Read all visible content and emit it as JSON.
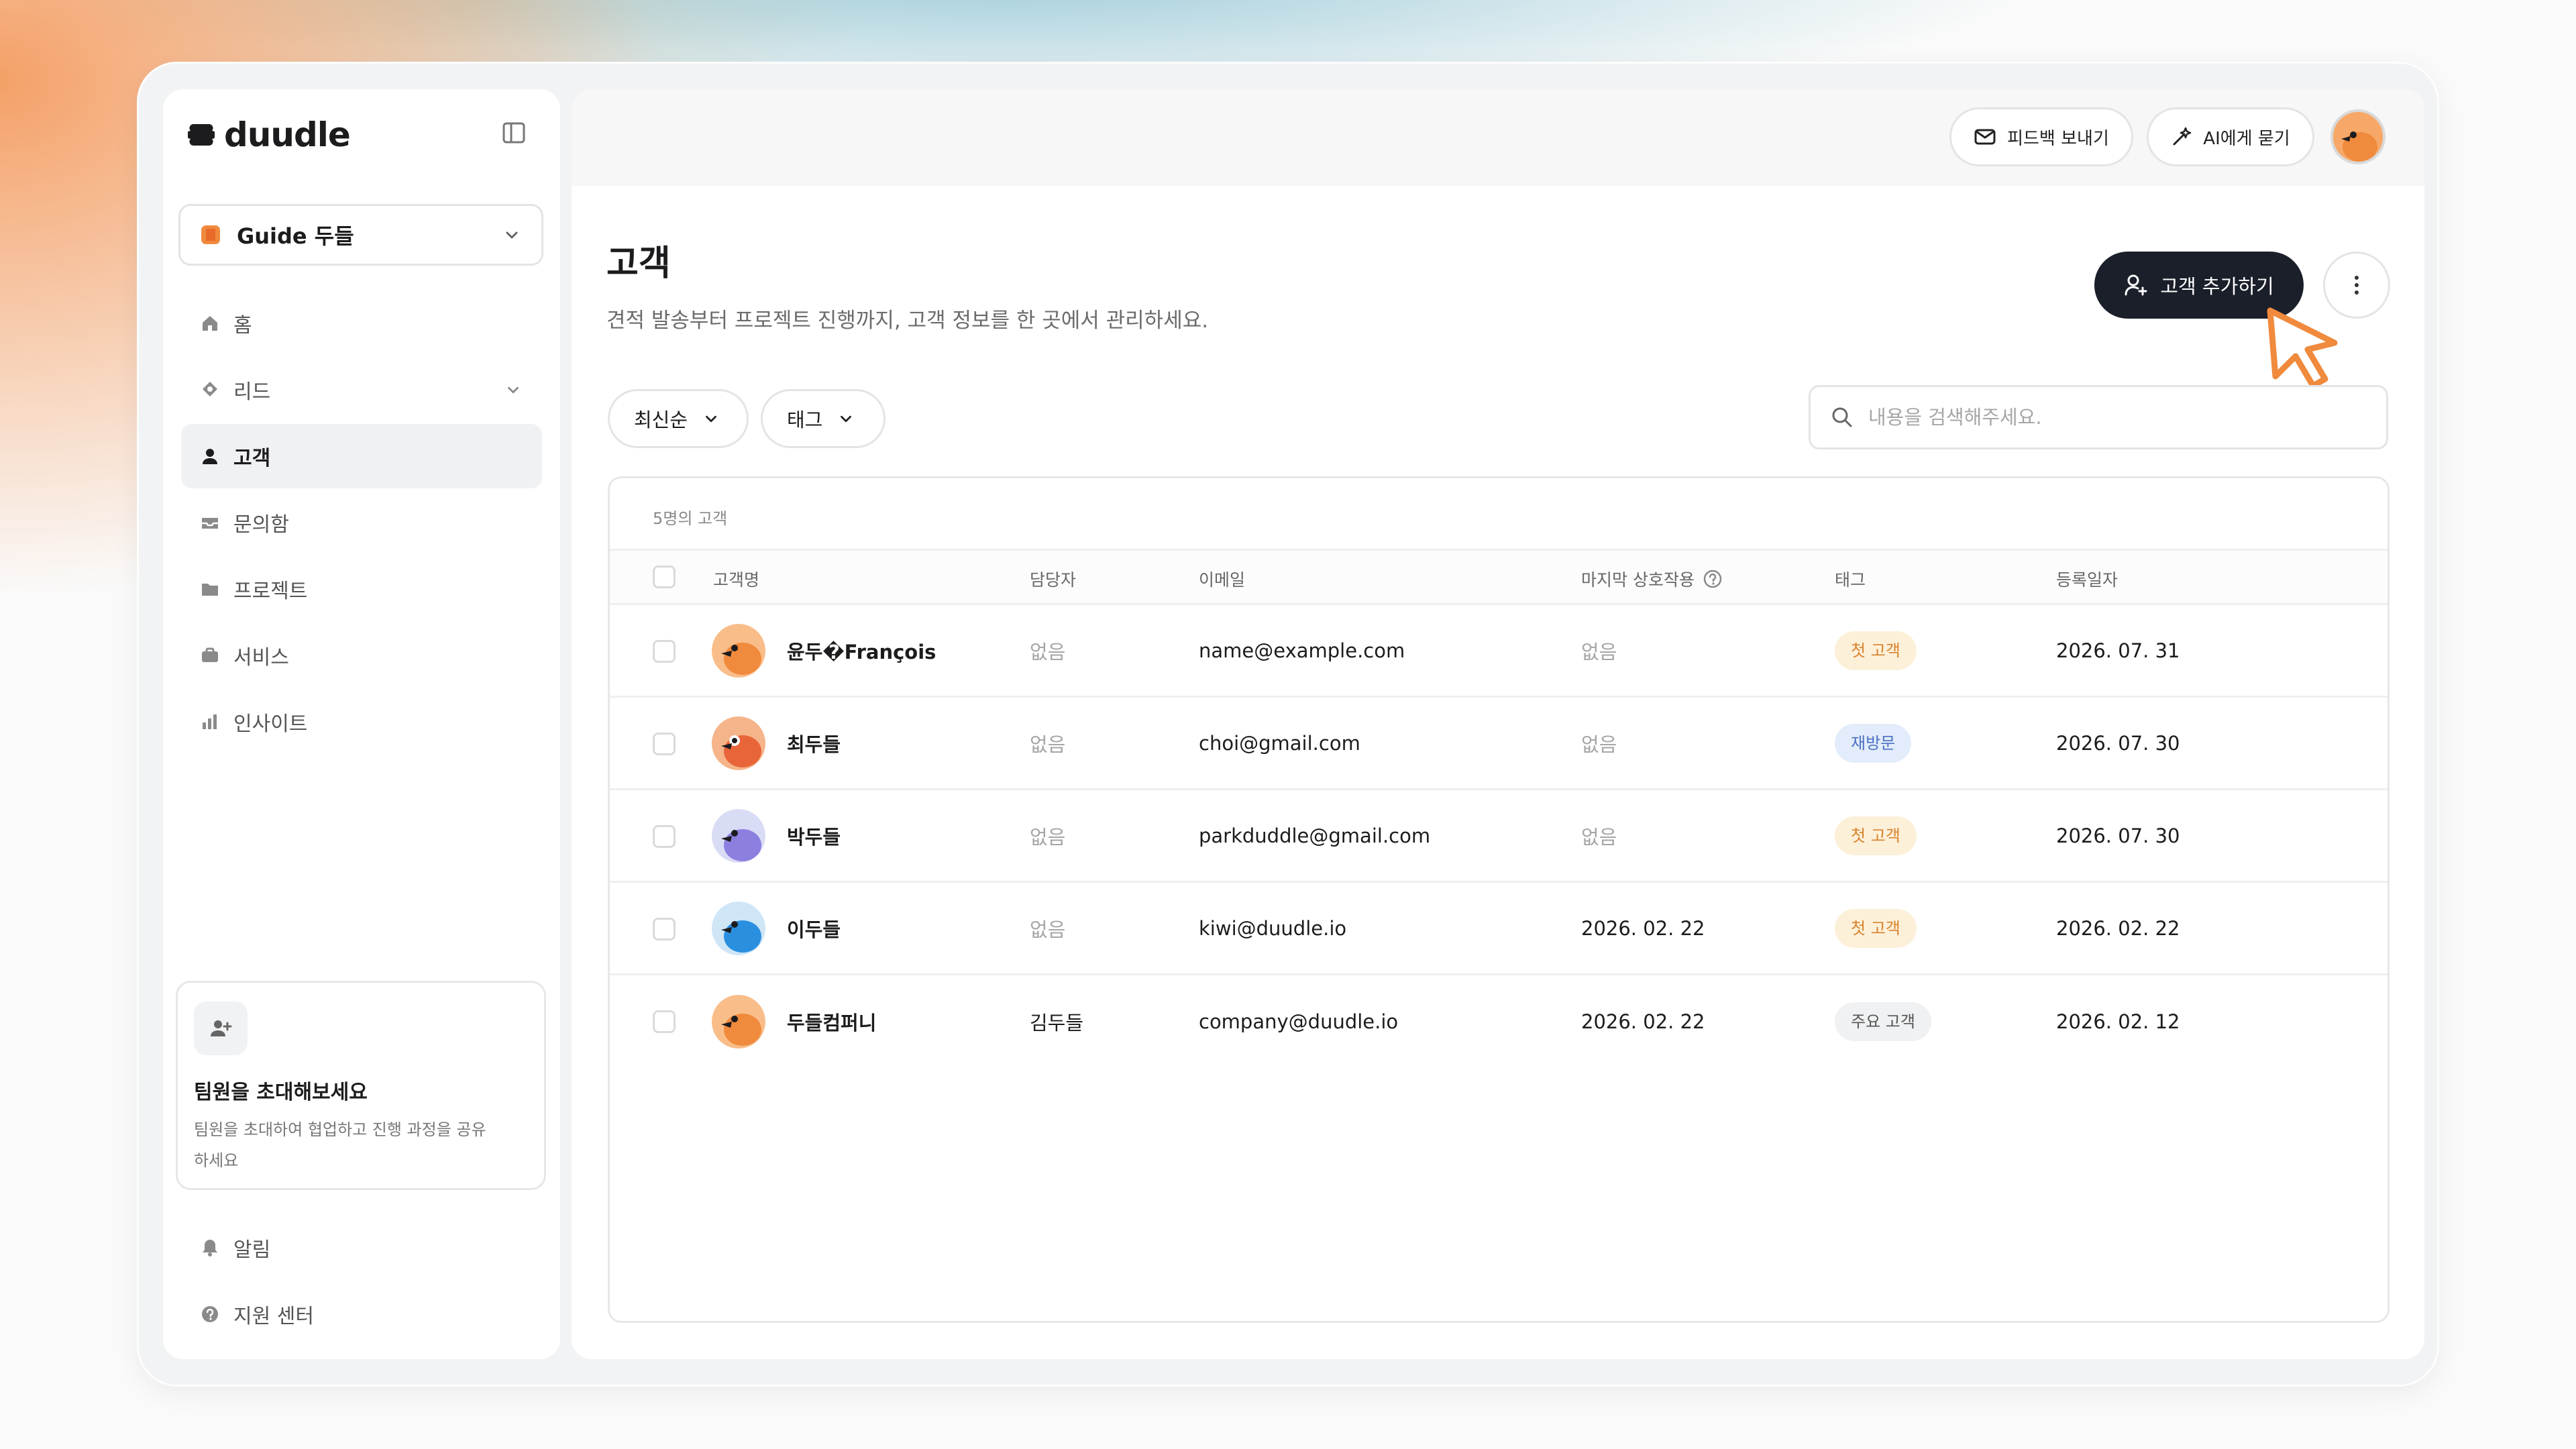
{
  "sidebar": {
    "logo": "duudle",
    "workspace": "Guide 두들",
    "nav": [
      {
        "label": "홈",
        "icon": "home-icon"
      },
      {
        "label": "리드",
        "icon": "lead-icon"
      },
      {
        "label": "고객",
        "icon": "person-icon"
      },
      {
        "label": "문의함",
        "icon": "inbox-icon"
      },
      {
        "label": "프로젝트",
        "icon": "folder-icon"
      },
      {
        "label": "서비스",
        "icon": "briefcase-icon"
      },
      {
        "label": "인사이트",
        "icon": "bar-chart-icon"
      }
    ],
    "invite": {
      "title": "팀원을 초대해보세요",
      "desc": "팀원을 초대하여 협업하고 진행 과정을 공유하세요"
    },
    "bottom": [
      {
        "label": "알림",
        "icon": "bell-icon"
      },
      {
        "label": "지원 센터",
        "icon": "help-icon"
      }
    ]
  },
  "header": {
    "feedback_label": "피드백 보내기",
    "ask_ai_label": "AI에게 묻기"
  },
  "page": {
    "title": "고객",
    "description": "견적 발송부터 프로젝트 진행까지, 고객 정보를 한 곳에서 관리하세요.",
    "add_button": "고객 추가하기"
  },
  "filters": {
    "sort": "최신순",
    "tag": "태그",
    "search_placeholder": "내용을 검색해주세요."
  },
  "table": {
    "count_label": "5명의 고객",
    "columns": [
      "고객명",
      "담당자",
      "이메일",
      "마지막 상호작용",
      "태그",
      "등록일자"
    ],
    "rows": [
      {
        "name": "윤두�François",
        "manager": "없음",
        "email": "name@example.com",
        "last": "없음",
        "tag": "첫 고객",
        "date": "2026. 07. 31"
      },
      {
        "name": "최두들",
        "manager": "없음",
        "email": "choi@gmail.com",
        "last": "없음",
        "tag": "재방문",
        "date": "2026. 07. 30"
      },
      {
        "name": "박두들",
        "manager": "없음",
        "email": "parkduddle@gmail.com",
        "last": "없음",
        "tag": "첫 고객",
        "date": "2026. 07. 30"
      },
      {
        "name": "이두들",
        "manager": "없음",
        "email": "kiwi@duudle.io",
        "last": "2026. 02. 22",
        "tag": "첫 고객",
        "date": "2026. 02. 22"
      },
      {
        "name": "두들컴퍼니",
        "manager": "김두들",
        "email": "company@duudle.io",
        "last": "2026. 02. 22",
        "tag": "주요 고객",
        "date": "2026. 02. 12"
      }
    ]
  },
  "colors": {
    "accent": "#1b1f2a",
    "cursor": "#f08a3c",
    "tag_first_bg": "#fdf0d9",
    "tag_first_fg": "#d9822b",
    "tag_revisit_bg": "#e3ecfa",
    "tag_revisit_fg": "#4a72c4",
    "tag_key_bg": "#f0f1f2",
    "tag_key_fg": "#555555"
  }
}
